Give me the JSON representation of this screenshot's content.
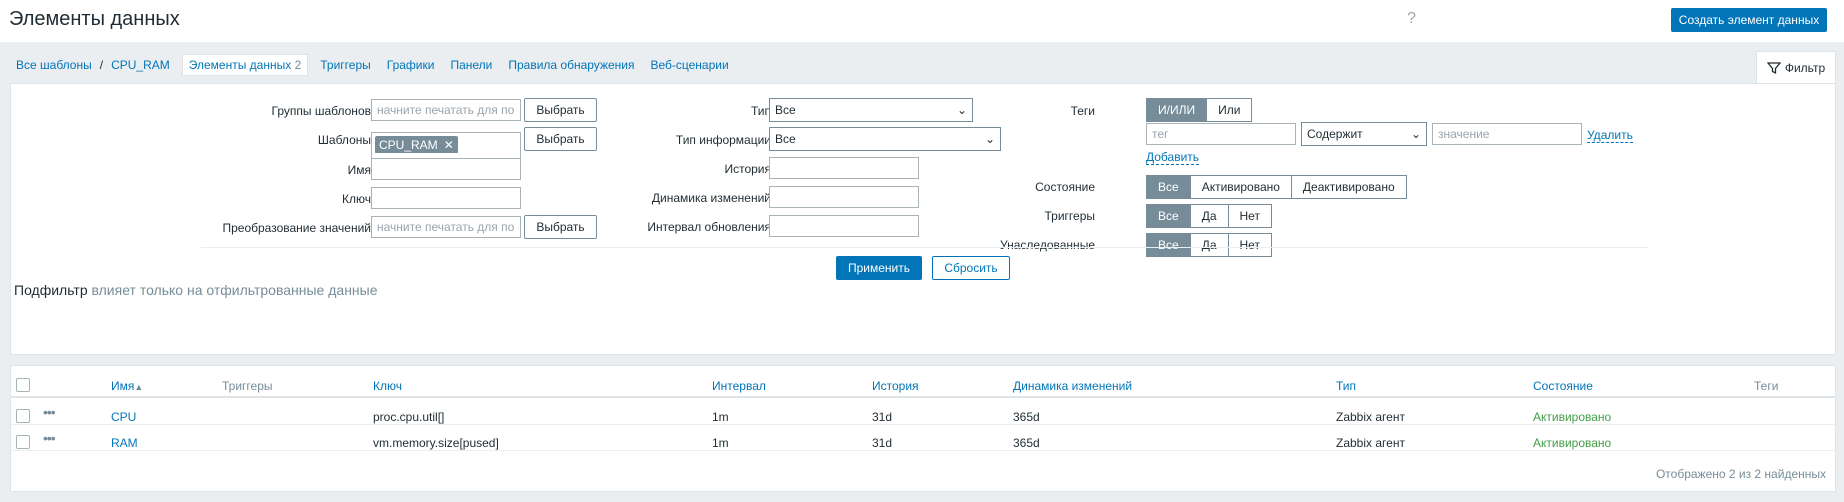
{
  "header": {
    "title": "Элементы данных",
    "help": "?",
    "create_button": "Создать элемент данных"
  },
  "nav": {
    "all_templates": "Все шаблоны",
    "separator": "/",
    "template": "CPU_RAM",
    "items_label": "Элементы данных",
    "items_count": "2",
    "triggers": "Триггеры",
    "graphs": "Графики",
    "dashboards": "Панели",
    "discovery": "Правила обнаружения",
    "web": "Веб-сценарии"
  },
  "filter_tab": "Фильтр",
  "filter": {
    "template_groups_label": "Группы шаблонов",
    "template_groups_placeholder": "начните печатать для по",
    "select_button": "Выбрать",
    "templates_label": "Шаблоны",
    "templates_chip": "CPU_RAM",
    "templates_placeholder": "начните печатать для по",
    "name_label": "Имя",
    "key_label": "Ключ",
    "valuemap_label": "Преобразование значений",
    "valuemap_placeholder": "начните печатать для по",
    "type_label": "Тип",
    "type_value": "Все",
    "info_type_label": "Тип информации",
    "info_type_value": "Все",
    "history_label": "История",
    "trends_label": "Динамика изменений",
    "interval_label": "Интервал обновления",
    "tags_label": "Теги",
    "tags_andor": "И/ИЛИ",
    "tags_or": "Или",
    "tag_placeholder": "тег",
    "tag_operator": "Содержит",
    "value_placeholder": "значение",
    "remove_link": "Удалить",
    "add_link": "Добавить",
    "state_label": "Состояние",
    "state_options": [
      "Все",
      "Активировано",
      "Деактивировано"
    ],
    "triggers_label": "Триггеры",
    "triggers_options": [
      "Все",
      "Да",
      "Нет"
    ],
    "inherited_label": "Унаследованные",
    "inherited_options": [
      "Все",
      "Да",
      "Нет"
    ],
    "apply_button": "Применить",
    "reset_button": "Сбросить"
  },
  "subfilter": {
    "title": "Подфильтр",
    "note": "влияет только на отфильтрованные данные"
  },
  "table": {
    "columns": {
      "name": "Имя",
      "sort_arrow": "▲",
      "triggers": "Триггеры",
      "key": "Ключ",
      "interval": "Интервал",
      "history": "История",
      "trends": "Динамика изменений",
      "type": "Тип",
      "status": "Состояние",
      "tags": "Теги"
    },
    "rows": [
      {
        "name": "CPU",
        "key": "proc.cpu.util[]",
        "interval": "1m",
        "history": "31d",
        "trends": "365d",
        "type": "Zabbix агент",
        "status": "Активировано"
      },
      {
        "name": "RAM",
        "key": "vm.memory.size[pused]",
        "interval": "1m",
        "history": "31d",
        "trends": "365d",
        "type": "Zabbix агент",
        "status": "Активировано"
      }
    ],
    "footer": "Отображено 2 из 2 найденных"
  }
}
